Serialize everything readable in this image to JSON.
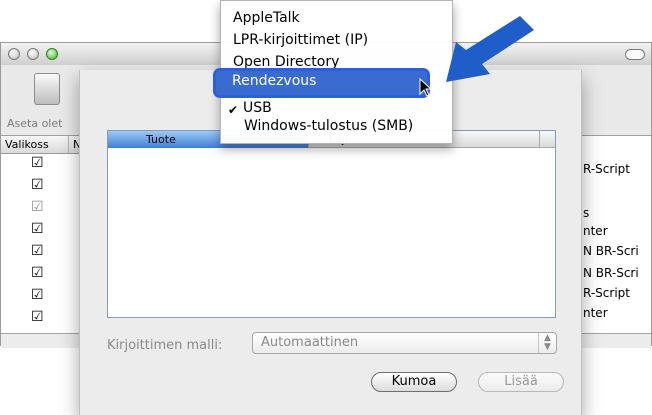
{
  "toolbar": {
    "button_label": "Aseta olet"
  },
  "printer_list": {
    "columns": [
      "Valikoss",
      "N"
    ],
    "checked_rows": 8,
    "right_partial_rows": [
      "R-Script",
      "",
      "s",
      "nter",
      "N BR-Scri",
      "N BR-Scri",
      "R-Script",
      "nter"
    ]
  },
  "menu": {
    "items": [
      "AppleTalk",
      "LPR-kirjoittimet (IP)",
      "Open Directory",
      "Rendezvous",
      "USB",
      "Windows-tulostus (SMB)"
    ],
    "selected": "Rendezvous",
    "checked_item": "USB"
  },
  "sheet": {
    "table_headers": [
      "Tuote",
      "Laji"
    ],
    "model_label": "Kirjoittimen malli:",
    "model_value": "Automaattinen",
    "cancel_label": "Kumoa",
    "add_label": "Lisää"
  },
  "colors": {
    "highlight": "#3a6ccf",
    "annotation_arrow": "#1f5ec8"
  }
}
